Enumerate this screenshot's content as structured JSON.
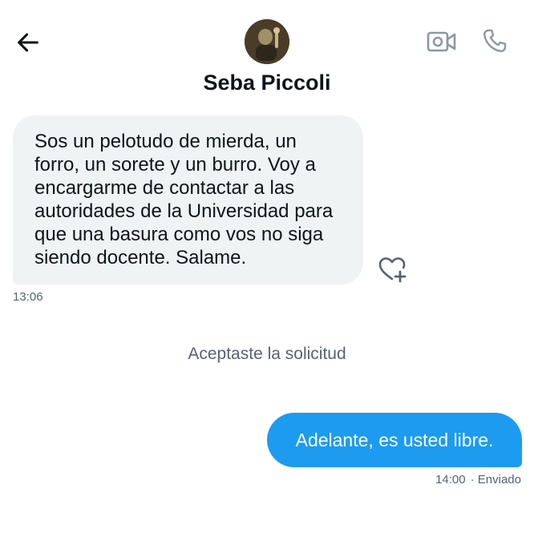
{
  "header": {
    "contact_name": "Seba Piccoli",
    "icons": {
      "back": "arrow-left-icon",
      "video": "video-camera-icon",
      "call": "phone-icon"
    }
  },
  "messages": [
    {
      "direction": "incoming",
      "text": "Sos un pelotudo de mierda, un forro, un sorete y un burro. Voy a encargarme de contactar a las autoridades de la Universidad para que una basura como vos no siga siendo docente. Salame.",
      "time": "13:06"
    },
    {
      "direction": "system",
      "text": "Aceptaste la solicitud"
    },
    {
      "direction": "outgoing",
      "text": "Adelante, es usted libre.",
      "time": "14:00",
      "status": "· Enviado"
    }
  ],
  "colors": {
    "accent": "#1d9bf0",
    "incoming_bubble": "#eff3f4",
    "secondary_text": "#536471",
    "primary_text": "#0f1419"
  }
}
